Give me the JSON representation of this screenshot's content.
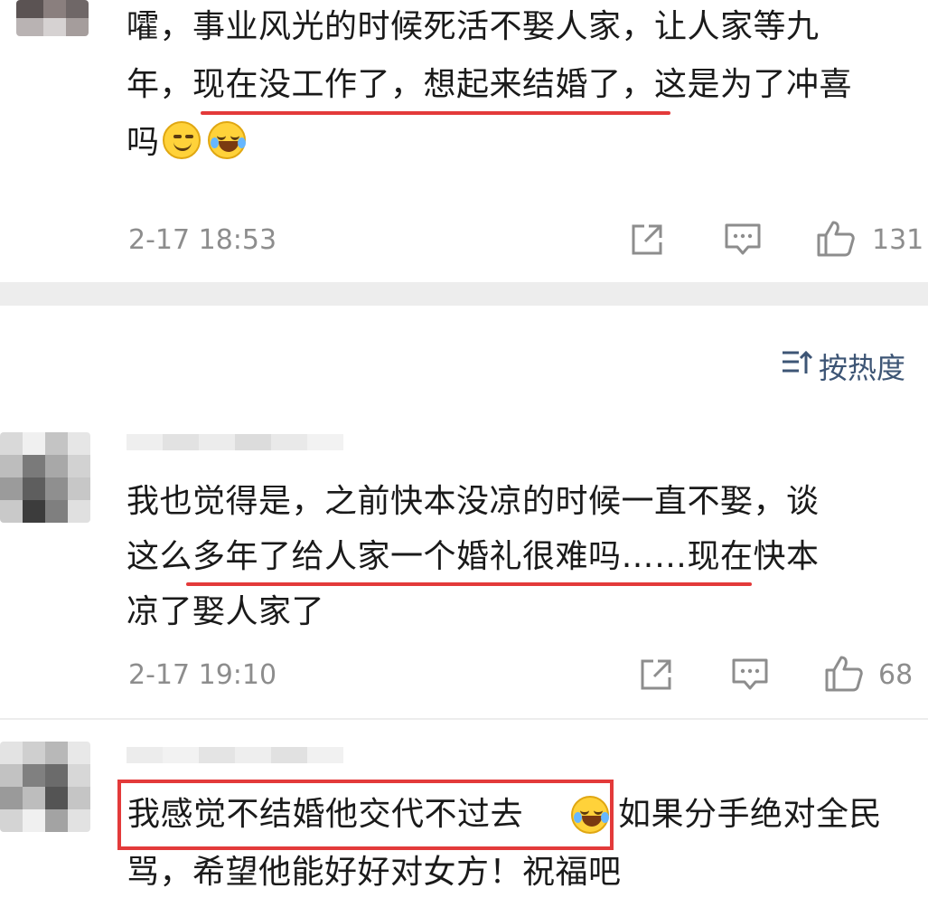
{
  "comments": [
    {
      "lines": [
        "嚯，事业风光的时候死活不娶人家，让人家等九",
        "年，现在没工作了，想起来结婚了，这是为了冲喜",
        "吗"
      ],
      "time": "2-17 18:53",
      "likes": "131"
    },
    {
      "lines": [
        "我也觉得是，之前快本没凉的时候一直不娶，谈",
        "这么多年了给人家一个婚礼很难吗……现在快本",
        "凉了娶人家了"
      ],
      "time": "2-17 19:10",
      "likes": "68"
    },
    {
      "line1_boxed": "我感觉不结婚他交代不过去",
      "line1_rest": "如果分手绝对全民",
      "line2": "骂，希望他能好好对女方！祝福吧"
    }
  ],
  "sort": {
    "label": "按热度"
  },
  "icons": [
    "share-icon",
    "reply-icon",
    "like-icon",
    "sort-icon",
    "smile-emoji",
    "laugh-cry-emoji"
  ],
  "colors": {
    "highlight": "#e33a3a",
    "meta_text": "#8d8d8d",
    "divider": "#ededed",
    "sort_text": "#3d5575"
  }
}
